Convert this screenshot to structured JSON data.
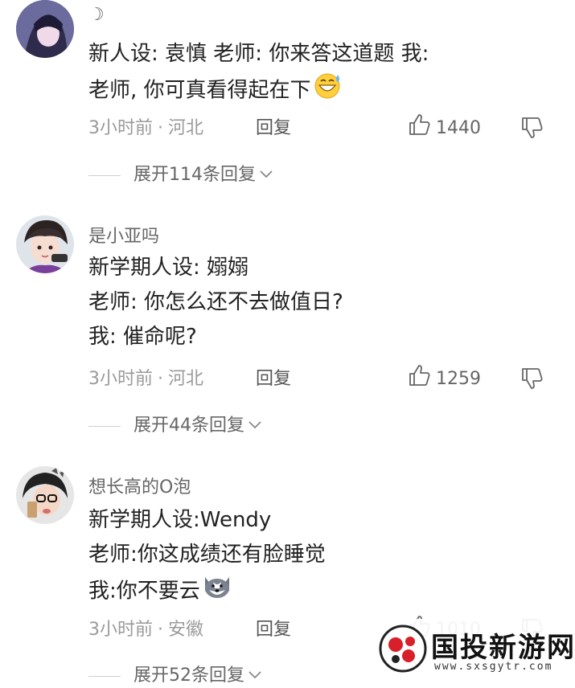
{
  "comments": [
    {
      "username": "☽",
      "lines": [
        "新人设:  袁慎   老师: 你来答这道题   我:",
        "老师,  你可真看得起在下"
      ],
      "emoji": "sweat-grin-emoji",
      "time": "3小时前",
      "location": "河北",
      "reply_label": "回复",
      "likes": "1440",
      "expand_label": "展开114条回复"
    },
    {
      "username": "是小亚吗",
      "lines": [
        "新学期人设: 嫋嫋",
        "老师: 你怎么还不去做值日?",
        "我: 催命呢?"
      ],
      "time": "3小时前",
      "location": "河北",
      "reply_label": "回复",
      "likes": "1259",
      "expand_label": "展开44条回复"
    },
    {
      "username": "想长高的O泡",
      "lines": [
        "新学期人设:Wendy",
        "老师:你这成绩还有脸睡觉",
        "我:你不要云"
      ],
      "emoji": "husky-dog-emoji",
      "time": "3小时前",
      "location": "安徽",
      "reply_label": "回复",
      "likes": "1010",
      "expand_label": "展开52条回复"
    }
  ],
  "watermark": {
    "title": "国投新游网",
    "url": "www.sxsgytr.com",
    "brand_color": "#d8202a"
  }
}
